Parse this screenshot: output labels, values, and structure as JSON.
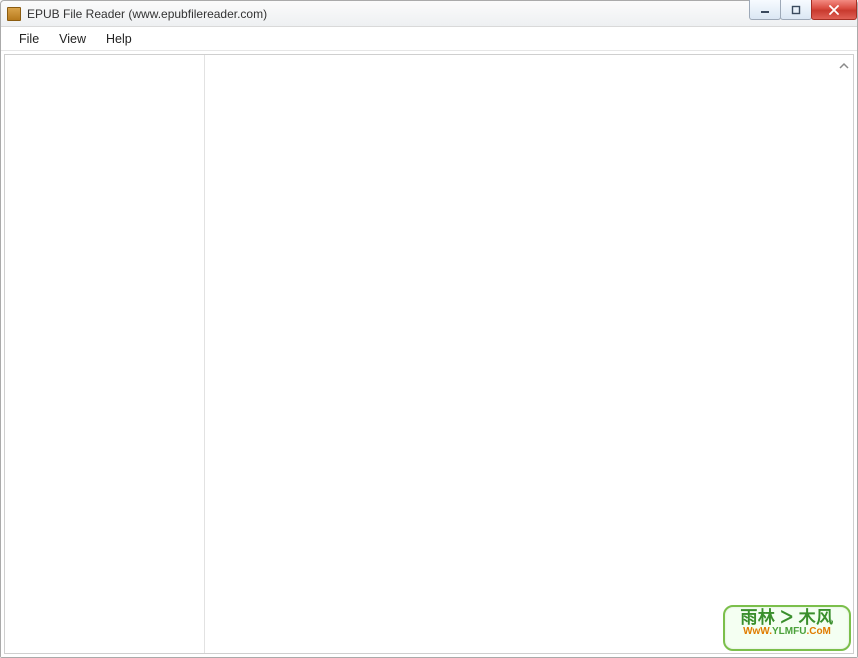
{
  "window": {
    "title": "EPUB File Reader (www.epubfilereader.com)"
  },
  "menu": {
    "items": [
      "File",
      "View",
      "Help"
    ]
  },
  "watermark": {
    "main": "雨林 ᐳ 木风",
    "sub_a": "WwW",
    "sub_b": "YLMFU",
    "sub_c": "CoM"
  }
}
